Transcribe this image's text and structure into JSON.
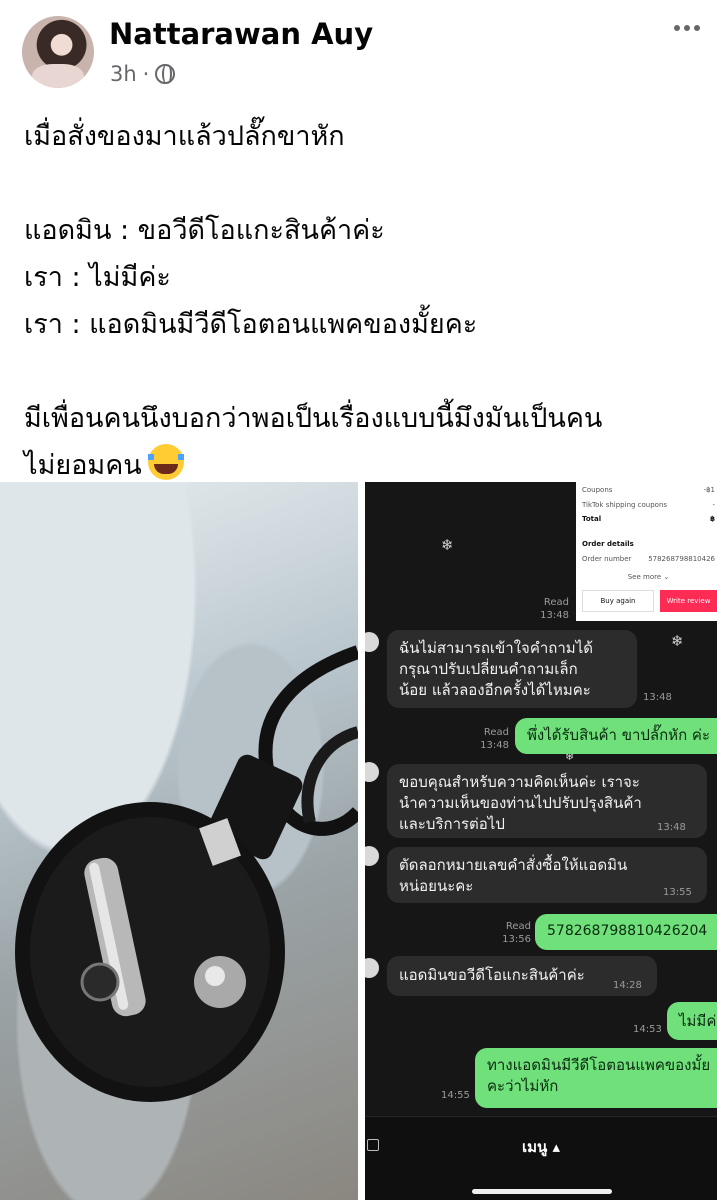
{
  "post": {
    "author": "Nattarawan Auy",
    "time": "3h",
    "separator": "·",
    "lines": [
      "เมื่อสั่งของมาแล้วปลั๊กขาหัก",
      "",
      "แอดมิน : ขอวีดีโอแกะสินค้าค่ะ",
      "เรา : ไม่มีค่ะ",
      "เรา : แอดมินมีวีดีโอตอนแพคของมั้ยคะ",
      "",
      "มีเพื่อนคนนึงบอกว่าพอเป็นเรื่องแบบนี้มึงมันเป็นคน",
      "ไม่ยอมคน"
    ]
  },
  "icons": {
    "privacy": "globe-icon",
    "more": "more-horizontal-icon",
    "emoji": "face-with-tears-of-joy-emoji"
  },
  "chat": {
    "order_card": {
      "coupons_label": "Coupons",
      "coupons_value": "-฿1",
      "shipping_label": "TikTok shipping coupons",
      "shipping_value": "-",
      "total_label": "Total",
      "total_value": "฿",
      "details_label": "Order details",
      "order_number_label": "Order number",
      "order_number_value": "578268798810426",
      "see_more": "See more ⌄",
      "buy_again": "Buy again",
      "write_review": "Write review"
    },
    "read_label": "Read",
    "t1": "13:48",
    "msg1": "ฉันไม่สามารถเข้าใจคำถามได้ กรุณาปรับเปลี่ยนคำถามเล็กน้อย แล้วลองอีกครั้งได้ไหมคะ",
    "msg1_time": "13:48",
    "out1_read_time": "13:48",
    "out1": "พึ่งได้รับสินค้า ขาปลั๊กหัก ค่ะ",
    "msg2": "ขอบคุณสำหรับความคิดเห็นค่ะ เราจะนำความเห็นของท่านไปปรับปรุงสินค้าและบริการต่อไป",
    "msg2_time": "13:48",
    "msg3": "ตัดลอกหมายเลขคำสั่งซื้อให้แอดมินหน่อยนะคะ",
    "msg3_time": "13:55",
    "out2_read_time": "13:56",
    "out2": "578268798810426204",
    "msg4": "แอดมินขอวีดีโอแกะสินค้าค่ะ",
    "msg4_time": "14:28",
    "out3": "ไม่มีค่ะ",
    "out3_time": "14:53",
    "out4": "ทางแอดมินมีวีดีโอตอนแพคของมั้ยคะว่าไม่หัก",
    "out4_time": "14:55",
    "menu": "เมนู ▴"
  },
  "colors": {
    "outgoing_bubble": "#6fe07a",
    "incoming_bubble": "#2c2c2c",
    "review_button": "#fe2c55",
    "chat_bg": "#161616"
  }
}
